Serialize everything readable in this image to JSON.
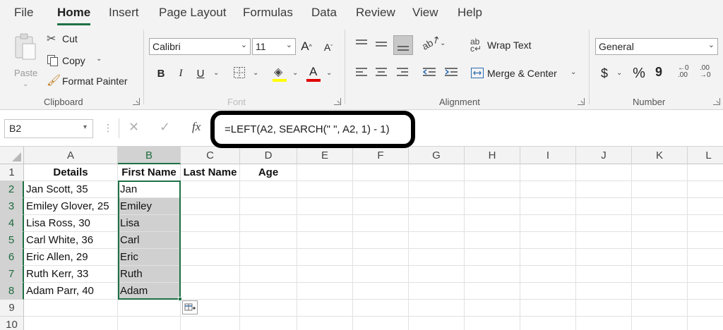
{
  "menu": {
    "tabs": [
      "File",
      "Home",
      "Insert",
      "Page Layout",
      "Formulas",
      "Data",
      "Review",
      "View",
      "Help"
    ],
    "active_tab": "Home"
  },
  "ribbon": {
    "clipboard": {
      "paste_label": "Paste",
      "cut_label": "Cut",
      "copy_label": "Copy",
      "format_painter_label": "Format Painter",
      "group_label": "Clipboard"
    },
    "font": {
      "font_name": "Calibri",
      "font_size": "11",
      "bold_label": "B",
      "italic_label": "I",
      "underline_label": "U",
      "grow_label": "A",
      "shrink_label": "A",
      "font_color_label": "A",
      "group_label": "Font",
      "highlight_color": "#ffff00",
      "font_color": "#e00000"
    },
    "alignment": {
      "wrap_text_label": "Wrap Text",
      "merge_center_label": "Merge & Center",
      "group_label": "Alignment"
    },
    "number": {
      "format_value": "General",
      "currency_label": "$",
      "percent_label": "%",
      "comma_label": "9",
      "group_label": "Number"
    }
  },
  "formula_bar": {
    "name_box": "B2",
    "fx_label": "fx",
    "formula": "=LEFT(A2, SEARCH(\" \", A2, 1) - 1)"
  },
  "grid": {
    "columns": [
      "A",
      "B",
      "C",
      "D",
      "E",
      "F",
      "G",
      "H",
      "I",
      "J",
      "K",
      "L"
    ],
    "rows": [
      "1",
      "2",
      "3",
      "4",
      "5",
      "6",
      "7",
      "8",
      "9",
      "10"
    ],
    "headers": {
      "A": "Details",
      "B": "First Name",
      "C": "Last Name",
      "D": "Age"
    },
    "details": [
      "Jan Scott, 35",
      "Emiley Glover, 25",
      "Lisa Ross, 30",
      "Carl White, 36",
      "Eric Allen, 29",
      "Ruth Kerr, 33",
      "Adam Parr, 40"
    ],
    "first_names": [
      "Jan",
      "Emiley",
      "Lisa",
      "Carl",
      "Eric",
      "Ruth",
      "Adam"
    ],
    "selection_color": "#1e7145"
  }
}
